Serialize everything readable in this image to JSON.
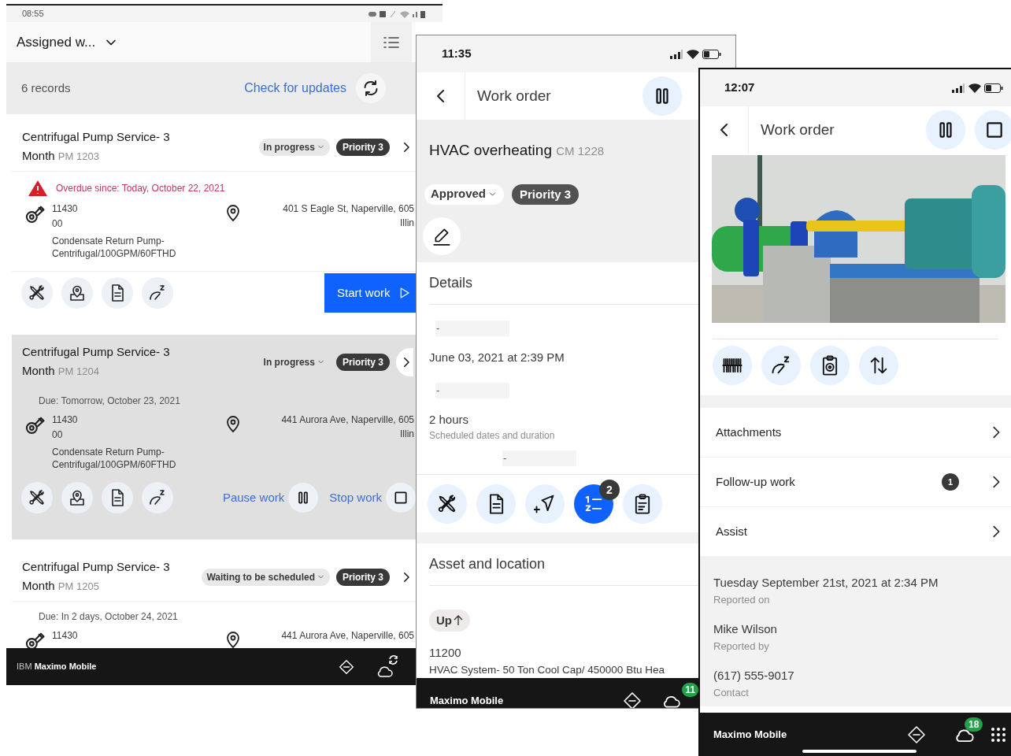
{
  "list_screen": {
    "status_time": "08:55",
    "view_title": "Assigned w...",
    "records": "6 records",
    "check_updates": "Check for updates",
    "work_orders": [
      {
        "title": "Centrifugal Pump Service- 3 Month",
        "number": "PM 1203",
        "status": "In progress",
        "priority": "Priority 3",
        "selected": false,
        "due": "Overdue since: Today, October 22, 2021",
        "overdue": true,
        "asset": "11430",
        "asset_line_2": "00",
        "asset_description": "Condensate Return Pump- Centrifugal/100GPM/60FTHD",
        "address": "401 S Eagle St, Naperville, 605",
        "address_line_2": "Illin",
        "actions": [
          {
            "kind": "start",
            "label": "Start work"
          }
        ]
      },
      {
        "title": "Centrifugal Pump Service- 3 Month",
        "number": "PM 1204",
        "status": "In progress",
        "priority": "Priority 3",
        "selected": true,
        "due": "Due: Tomorrow, October 23, 2021",
        "overdue": false,
        "asset": "11430",
        "asset_line_2": "00",
        "asset_description": "Condensate Return Pump- Centrifugal/100GPM/60FTHD",
        "address": "441 Aurora Ave, Naperville, 605",
        "address_line_2": "Illin",
        "actions": [
          {
            "kind": "pause",
            "label": "Pause work"
          },
          {
            "kind": "stop",
            "label": "Stop work"
          }
        ]
      },
      {
        "title": "Centrifugal Pump Service- 3 Month",
        "number": "PM 1205",
        "status": "Waiting to be scheduled",
        "priority": "Priority 3",
        "selected": false,
        "due": "Due: In 2 days, October 24, 2021",
        "overdue": false,
        "asset": "11430",
        "address": "441 Aurora Ave, Naperville, 605"
      }
    ],
    "footer": "IBM **Maximo Mobile**"
  },
  "detail_screen": {
    "status_time": "11:35",
    "title": "Work order",
    "wo_title": "HVAC overheating",
    "number": "CM 1228",
    "status": "Approved",
    "priority": "Priority 3",
    "details_heading": "Details",
    "details": [
      {
        "kind": "blank",
        "value": "-"
      },
      {
        "kind": "value",
        "value": "June 03, 2021 at 2:39 PM"
      },
      {
        "kind": "blank",
        "value": "-"
      },
      {
        "kind": "value",
        "value": "2 hours",
        "label": "Scheduled dates and duration"
      },
      {
        "kind": "blank-offset",
        "value": "-"
      }
    ],
    "actions": [
      {
        "kind": "tools",
        "selected": false
      },
      {
        "kind": "document",
        "selected": false
      },
      {
        "kind": "navigate",
        "selected": false
      },
      {
        "kind": "task-list",
        "selected": true,
        "badge": "2"
      },
      {
        "kind": "clipboard",
        "selected": false
      }
    ],
    "asset_heading": "Asset and location",
    "asset_status": "Up",
    "asset": "11200",
    "asset_description": "HVAC System- 50 Ton Cool Cap/ 450000 Btu Hea",
    "footer": "Maximo Mobile",
    "sync_count": "11"
  },
  "photo_screen": {
    "status_time": "12:07",
    "title": "Work order",
    "actions": [
      {
        "kind": "barcode"
      },
      {
        "kind": "meter"
      },
      {
        "kind": "clipboard-gear"
      },
      {
        "kind": "sort"
      }
    ],
    "links": [
      {
        "label": "Attachments"
      },
      {
        "label": "Follow-up work",
        "count": "1"
      },
      {
        "label": "Assist"
      }
    ],
    "info": [
      {
        "value": "Tuesday September 21st, 2021 at 2:34 PM",
        "label": "Reported on"
      },
      {
        "value": "Mike Wilson",
        "label": "Reported by"
      },
      {
        "value": "(617) 555-9017",
        "label": "Contact"
      }
    ],
    "footer": "Maximo Mobile",
    "sync_count": "18"
  }
}
